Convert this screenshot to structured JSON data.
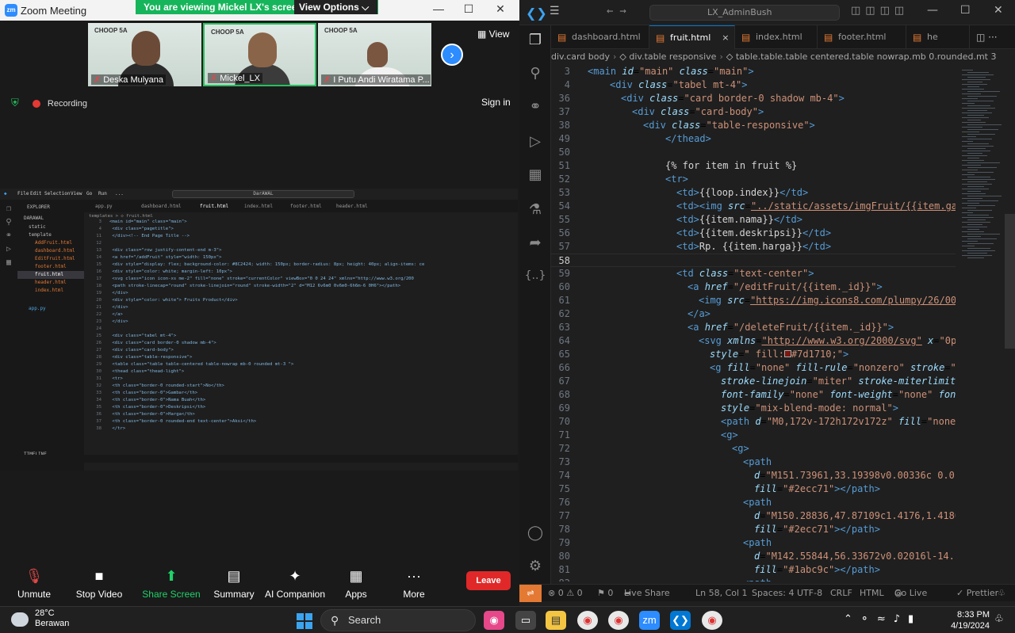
{
  "zoom": {
    "title": "Zoom Meeting",
    "share_banner": "You are viewing Mickel LX's screen",
    "view_options": "View Options ⌵",
    "participants": [
      {
        "name": "Deska Mulyana",
        "logo": "CHOOP 5A"
      },
      {
        "name": "Mickel_LX",
        "logo": "CHOOP 5A"
      },
      {
        "name": "I Putu Andi Wiratama P...",
        "logo": "CHOOP 5A"
      }
    ],
    "view_label": "View",
    "recording_label": "Recording",
    "sign_in": "Sign in",
    "toolbar": {
      "unmute": "Unmute",
      "stop_video": "Stop Video",
      "share_screen": "Share Screen",
      "summary": "Summary",
      "ai_companion": "AI Companion",
      "apps": "Apps",
      "more": "More",
      "leave": "Leave"
    }
  },
  "shared_screen": {
    "menu": [
      "File",
      "Edit",
      "Selection",
      "View",
      "Go",
      "Run",
      "..."
    ],
    "search": "DarAWAL",
    "explorer_title": "EXPLORER",
    "folder": "DARAWAL",
    "tree": [
      "static",
      "template",
      "AddFruit.html",
      "dashboard.html",
      "EditFruit.html",
      "footer.html",
      "fruit.html",
      "header.html",
      "index.html",
      "app.py"
    ],
    "timeline": "TIMELINE",
    "tabs": [
      "app.py",
      "dashboard.html",
      "fruit.html",
      "index.html",
      "footer.html",
      "header.html"
    ],
    "breadcrumb": "templates > ◇ fruit.html",
    "code": [
      {
        "n": "3",
        "t": "<main id=\"main\" class=\"main\">"
      },
      {
        "n": "4",
        "t": "  <div class=\"pagetitle\">"
      },
      {
        "n": "11",
        "t": "  </div><!-- End Page Title -->"
      },
      {
        "n": "12",
        "t": ""
      },
      {
        "n": "13",
        "t": "  <div class=\"row justify-content-end m-3\">"
      },
      {
        "n": "14",
        "t": "    <a href=\"/addFruit\" style=\"width: 150px\">"
      },
      {
        "n": "15",
        "t": "      <div style=\"display: flex; background-color: #8C2424; width: 150px; border-radius: 8px; height: 40px; align-items: ce"
      },
      {
        "n": "16",
        "t": "        <div style=\"color: white; margin-left: 10px\">"
      },
      {
        "n": "17",
        "t": "          <svg class=\"icon icon-xs me-2\" fill=\"none\" stroke=\"currentColor\" viewBox=\"0 0 24 24\" xmlns=\"http://www.w3.org/200"
      },
      {
        "n": "18",
        "t": "            <path stroke-linecap=\"round\" stroke-linejoin=\"round\" stroke-width=\"2\" d=\"M12 6v6m0 0v6m0-6h6m-6 0H6\"></path>"
      },
      {
        "n": "19",
        "t": "        </div>"
      },
      {
        "n": "20",
        "t": "        <div style=\"color: white\"> Fruits Product</div>"
      },
      {
        "n": "21",
        "t": "      </div>"
      },
      {
        "n": "22",
        "t": "    </a>"
      },
      {
        "n": "23",
        "t": "  </div>"
      },
      {
        "n": "24",
        "t": ""
      },
      {
        "n": "25",
        "t": "  <div class=\"tabel mt-4\">"
      },
      {
        "n": "26",
        "t": "    <div class=\"card border-0 shadow mb-4\">"
      },
      {
        "n": "27",
        "t": "      <div class=\"card-body\">"
      },
      {
        "n": "28",
        "t": "        <div class=\"table-responsive\">"
      },
      {
        "n": "29",
        "t": "          <table class=\"table table-centered table-nowrap mb-0 rounded mt-3 \">"
      },
      {
        "n": "30",
        "t": "            <thead class=\"thead-light\">"
      },
      {
        "n": "31",
        "t": "              <tr>"
      },
      {
        "n": "32",
        "t": "                <th class=\"border-0 rounded-start\">No</th>"
      },
      {
        "n": "33",
        "t": "                <th class=\"border-0\">Gambar</th>"
      },
      {
        "n": "34",
        "t": "                <th class=\"border-0\">Nama Buah</th>"
      },
      {
        "n": "35",
        "t": "                <th class=\"border-0\">Deskripsi</th>"
      },
      {
        "n": "36",
        "t": "                <th class=\"border-0\">Harga</th>"
      },
      {
        "n": "37",
        "t": "                <th class=\"border-0 rounded-end text-center\">Aksi</th>"
      },
      {
        "n": "38",
        "t": "              </tr>"
      }
    ]
  },
  "vscode": {
    "search": "LX_AdminBush",
    "tabs": [
      {
        "label": "dashboard.html"
      },
      {
        "label": "fruit.html",
        "close": "×"
      },
      {
        "label": "index.html"
      },
      {
        "label": "footer.html"
      },
      {
        "label": "he"
      }
    ],
    "breadcrumb": [
      "div.card body",
      "div.table responsive",
      "table.table.table centered.table nowrap.mb 0.rounded.mt 3"
    ],
    "status": {
      "errors": "⊗ 0 ⚠ 0",
      "ports": "⚑ 0",
      "live_share": "Live Share",
      "position": "Ln 58, Col 1",
      "spaces": "Spaces: 4",
      "encoding": "UTF-8",
      "eol": "CRLF",
      "language": "HTML",
      "go_live": "Go Live",
      "prettier": "✓ Prettier"
    }
  },
  "taskbar": {
    "weather_temp": "28°C",
    "weather_desc": "Berawan",
    "search": "Search",
    "time": "8:33 PM",
    "date": "4/19/2024"
  }
}
